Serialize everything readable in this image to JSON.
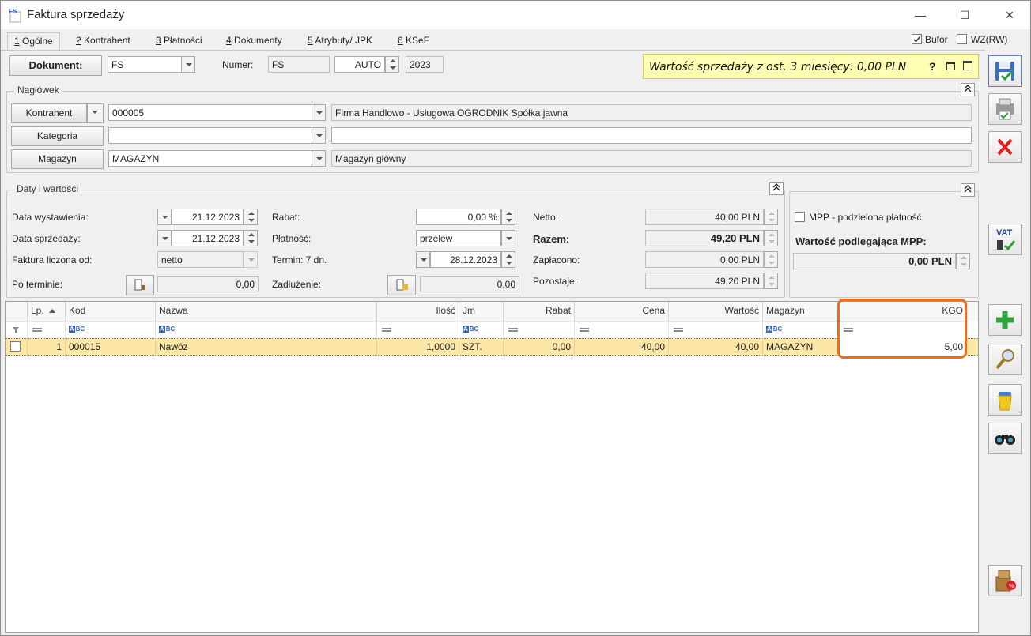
{
  "window": {
    "title": "Faktura sprzedaży",
    "icon_text": "FS",
    "min": "—",
    "max": "☐",
    "close": "✕"
  },
  "tabs": [
    {
      "num": "1",
      "label": " Ogólne"
    },
    {
      "num": "2",
      "label": " Kontrahent"
    },
    {
      "num": "3",
      "label": " Płatności"
    },
    {
      "num": "4",
      "label": " Dokumenty"
    },
    {
      "num": "5",
      "label": " Atrybuty/ JPK"
    },
    {
      "num": "6",
      "label": " KSeF"
    }
  ],
  "flags": {
    "bufor": "Bufor",
    "bufor_checked": true,
    "wz": "WZ(RW)",
    "wz_checked": false
  },
  "doc": {
    "button": "Dokument:",
    "type": "FS",
    "numer_label": "Numer:",
    "numer_prefix": "FS",
    "numer_auto": "AUTO",
    "numer_year": "2023"
  },
  "notice": {
    "text": "Wartość sprzedaży z ost. 3 miesięcy: 0,00 PLN",
    "help": "?"
  },
  "naglowek": {
    "title": "Nagłówek",
    "kontrahent_btn": "Kontrahent",
    "kontrahent_code": "000005",
    "kontrahent_name": "Firma Handlowo - Usługowa OGRODNIK Spółka jawna",
    "kategoria_btn": "Kategoria",
    "kategoria_code": "",
    "kategoria_desc": "",
    "magazyn_btn": "Magazyn",
    "magazyn_code": "MAGAZYN",
    "magazyn_name": "Magazyn główny",
    "collapse": "⌃"
  },
  "daty": {
    "title": "Daty i wartości",
    "data_wyst_label": "Data wystawienia:",
    "data_wyst": "21.12.2023",
    "data_sprz_label": "Data sprzedaży:",
    "data_sprz": "21.12.2023",
    "liczona_label": "Faktura liczona od:",
    "liczona": "netto",
    "po_terminie_label": "Po terminie:",
    "po_terminie": "0,00",
    "rabat_label": "Rabat:",
    "rabat": "0,00 %",
    "platnosc_label": "Płatność:",
    "platnosc": "przelew",
    "termin_label": "Termin: 7 dn.",
    "termin": "28.12.2023",
    "zadluzenie_label": "Zadłużenie:",
    "zadluzenie": "0,00",
    "netto_label": "Netto:",
    "netto": "40,00 PLN",
    "razem_label": "Razem:",
    "razem": "49,20 PLN",
    "zaplacono_label": "Zapłacono:",
    "zaplacono": "0,00 PLN",
    "pozostaje_label": "Pozostaje:",
    "pozostaje": "49,20 PLN"
  },
  "mpp": {
    "checkbox_label": "MPP - podzielona płatność",
    "value_label": "Wartość podlegająca MPP:",
    "value": "0,00 PLN"
  },
  "grid": {
    "headers": {
      "lp": "Lp.",
      "kod": "Kod",
      "nazwa": "Nazwa",
      "ilosc": "Ilość",
      "jm": "Jm",
      "rabat": "Rabat",
      "cena": "Cena",
      "wartosc": "Wartość",
      "magazyn": "Magazyn",
      "kgo": "KGO"
    },
    "rows": [
      {
        "lp": "1",
        "kod": "000015",
        "nazwa": "Nawóz",
        "ilosc": "1,0000",
        "jm": "SZT.",
        "rabat": "0,00",
        "cena": "40,00",
        "wartosc": "40,00",
        "magazyn": "MAGAZYN",
        "kgo": "5,00"
      }
    ]
  },
  "sidebar": {
    "vat": "VAT"
  },
  "colors": {
    "highlight_row": "#fde7a6",
    "notice_bg": "#ffffb3",
    "kgo_outline": "#ee6c1c"
  }
}
